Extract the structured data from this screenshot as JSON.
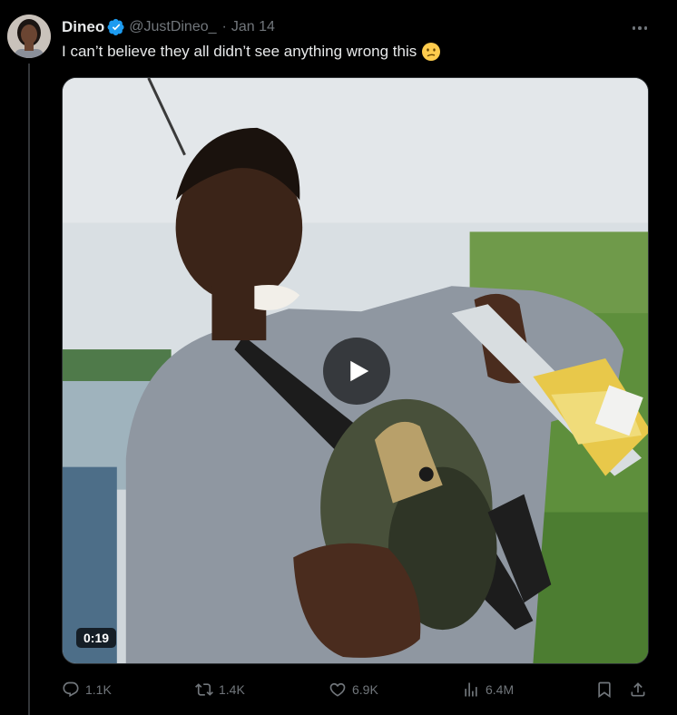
{
  "tweet": {
    "author_name": "Dineo",
    "handle": "@JustDineo_",
    "separator": "·",
    "date": "Jan 14",
    "text": "I can’t believe they all didn’t see anything wrong this",
    "emoji": "confused-face",
    "verified": true
  },
  "media": {
    "type": "video",
    "duration": "0:19"
  },
  "actions": {
    "replies": "1.1K",
    "retweets": "1.4K",
    "likes": "6.9K",
    "views": "6.4M"
  },
  "colors": {
    "background": "#000000",
    "text": "#e7e9ea",
    "muted": "#71767b",
    "verified": "#1d9bf0"
  }
}
